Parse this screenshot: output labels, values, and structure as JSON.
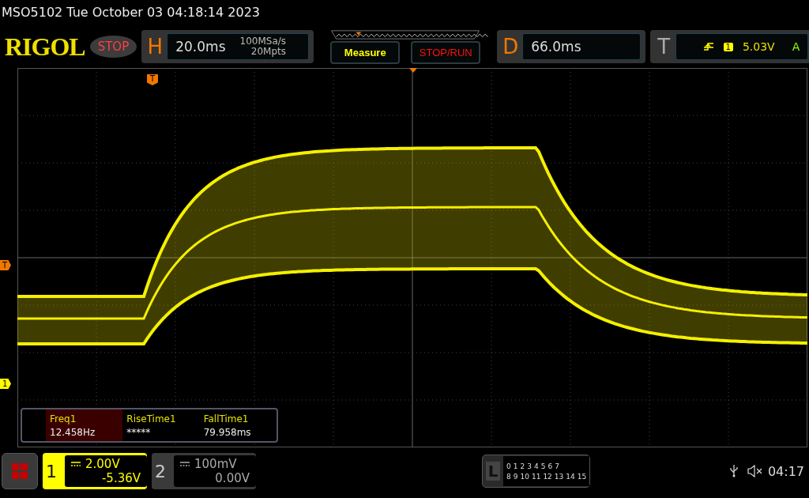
{
  "status_line": "MSO5102  Tue October 03 04:18:14 2023",
  "header": {
    "logo": "RIGOL",
    "run_state": "STOP",
    "horizontal": {
      "label": "H",
      "timebase": "20.0ms",
      "sample_rate": "100MSa/s",
      "memory_depth": "20Mpts"
    },
    "buttons": [
      {
        "label": "Measure",
        "kind": "measure"
      },
      {
        "label": "STOP/RUN",
        "kind": "run"
      }
    ],
    "delay": {
      "label": "D",
      "value": "66.0ms"
    },
    "trigger": {
      "label": "T",
      "source": "1",
      "level": "5.03V",
      "mode": "A"
    }
  },
  "markers": {
    "top_trigger": "T",
    "trigger_level": "T",
    "channel": "1"
  },
  "measurements": [
    {
      "name": "Freq1",
      "value": "12.458Hz",
      "selected": true
    },
    {
      "name": "RiseTime1",
      "value": "*****",
      "selected": false
    },
    {
      "name": "FallTime1",
      "value": "79.958ms",
      "selected": false
    }
  ],
  "channels": [
    {
      "number": "1",
      "scale": "2.00V",
      "offset": "-5.36V",
      "selected": true
    },
    {
      "number": "2",
      "scale": "100mV",
      "offset": "0.00V",
      "selected": false
    }
  ],
  "logic": {
    "label": "L",
    "row_1": [
      "0",
      "1",
      "2",
      "3",
      "4",
      "5",
      "6",
      "7"
    ],
    "row_2": [
      "8",
      "9",
      "10",
      "11",
      "12",
      "13",
      "14",
      "15"
    ]
  },
  "clock": "04:17"
}
